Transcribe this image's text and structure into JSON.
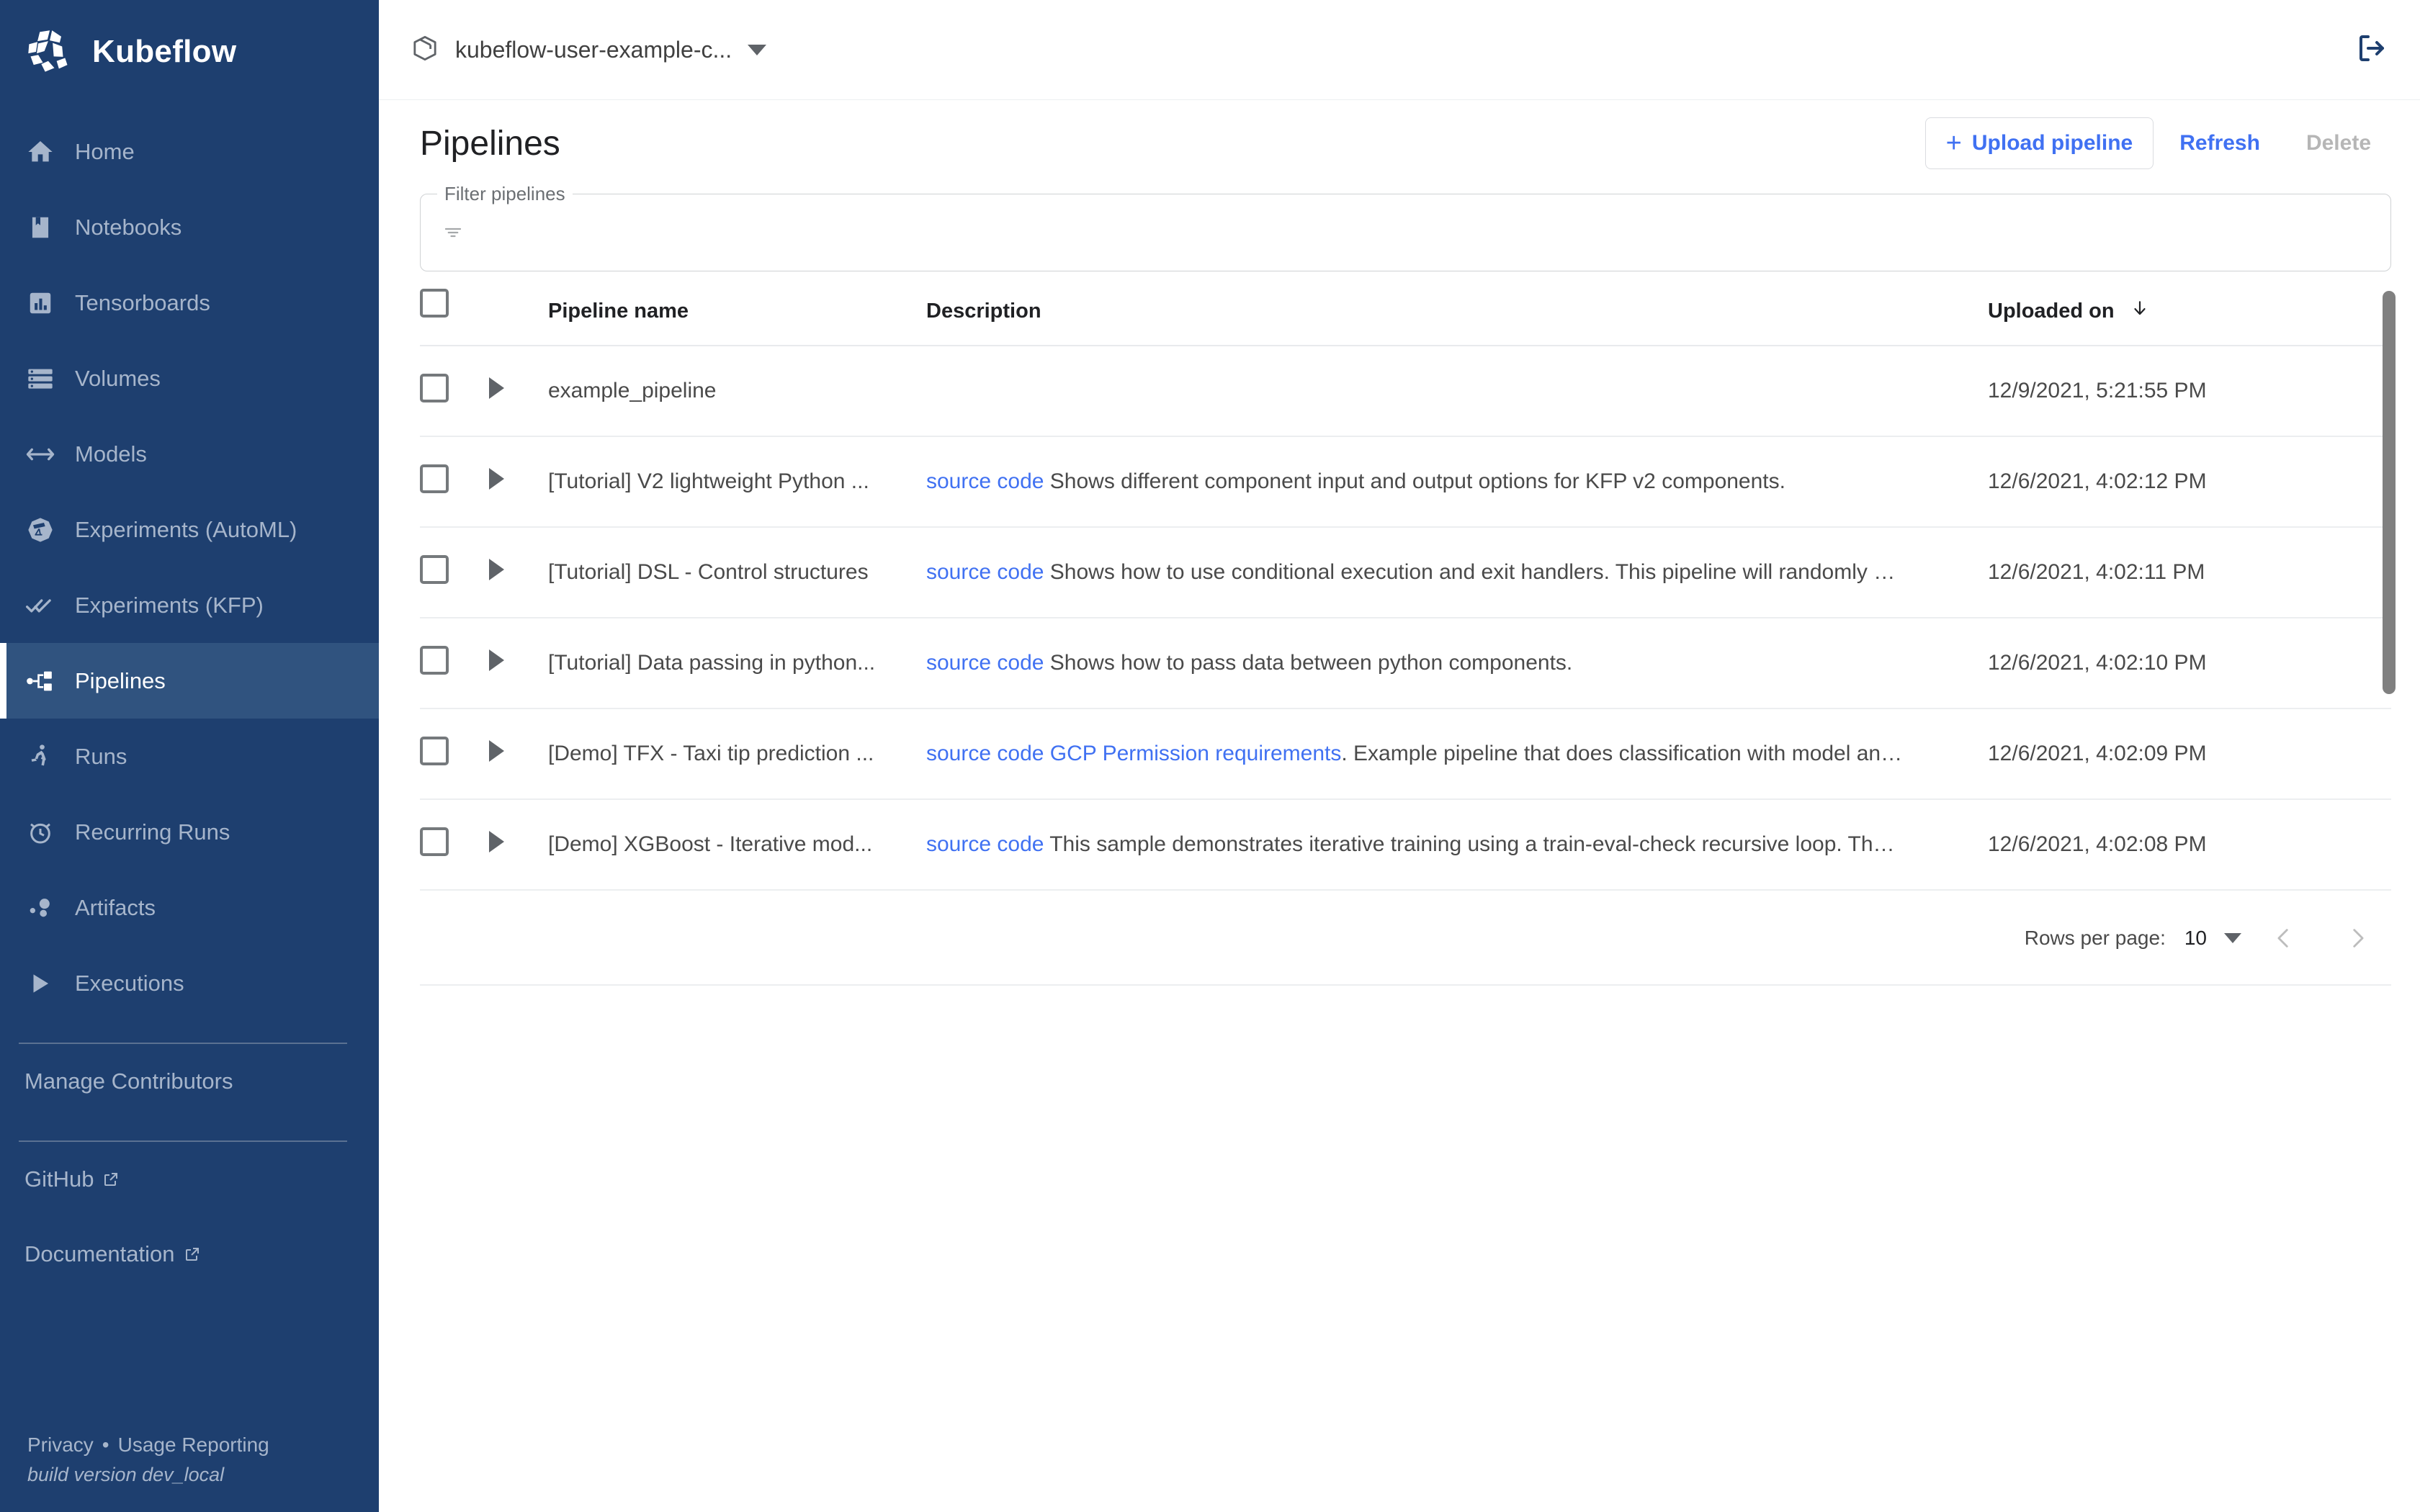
{
  "brand": {
    "name": "Kubeflow",
    "logo_icon": "kubeflow-logo-icon"
  },
  "sidebar": {
    "items": [
      {
        "label": "Home",
        "icon": "home-icon",
        "active": false
      },
      {
        "label": "Notebooks",
        "icon": "notebook-icon",
        "active": false
      },
      {
        "label": "Tensorboards",
        "icon": "bar-chart-icon",
        "active": false
      },
      {
        "label": "Volumes",
        "icon": "storage-icon",
        "active": false
      },
      {
        "label": "Models",
        "icon": "code-arrows-icon",
        "active": false
      },
      {
        "label": "Experiments (AutoML)",
        "icon": "telescope-icon",
        "active": false
      },
      {
        "label": "Experiments (KFP)",
        "icon": "double-check-icon",
        "active": false
      },
      {
        "label": "Pipelines",
        "icon": "pipeline-icon",
        "active": true
      },
      {
        "label": "Runs",
        "icon": "runner-icon",
        "active": false
      },
      {
        "label": "Recurring Runs",
        "icon": "alarm-clock-icon",
        "active": false
      },
      {
        "label": "Artifacts",
        "icon": "artifacts-icon",
        "active": false
      },
      {
        "label": "Executions",
        "icon": "play-triangle-icon",
        "active": false
      }
    ],
    "manage_contributors": "Manage Contributors",
    "github": "GitHub",
    "documentation": "Documentation",
    "privacy": "Privacy",
    "usage_reporting": "Usage Reporting",
    "separator": "•",
    "build_version": "build version dev_local"
  },
  "topbar": {
    "namespace": "kubeflow-user-example-c...",
    "namespace_icon": "package-cube-icon",
    "logout_icon": "logout-icon"
  },
  "page": {
    "title": "Pipelines",
    "upload_label": "Upload pipeline",
    "upload_plus": "+",
    "refresh_label": "Refresh",
    "delete_label": "Delete"
  },
  "filter": {
    "legend": "Filter pipelines",
    "value": "",
    "placeholder": "",
    "icon": "filter-icon"
  },
  "table": {
    "columns": {
      "pipeline_name": "Pipeline name",
      "description": "Description",
      "uploaded_on": "Uploaded on"
    },
    "sort_icon": "arrow-down-icon",
    "rows": [
      {
        "name": "example_pipeline",
        "desc_link": "",
        "desc_link2": "",
        "desc_text": "",
        "uploaded_on": "12/9/2021, 5:21:55 PM"
      },
      {
        "name": "[Tutorial] V2 lightweight Python ...",
        "desc_link": "source code",
        "desc_link2": "",
        "desc_text": " Shows different component input and output options for KFP v2 components.",
        "uploaded_on": "12/6/2021, 4:02:12 PM"
      },
      {
        "name": "[Tutorial] DSL - Control structures",
        "desc_link": "source code",
        "desc_link2": "",
        "desc_text": " Shows how to use conditional execution and exit handlers. This pipeline will randomly …",
        "uploaded_on": "12/6/2021, 4:02:11 PM"
      },
      {
        "name": "[Tutorial] Data passing in python...",
        "desc_link": "source code",
        "desc_link2": "",
        "desc_text": " Shows how to pass data between python components.",
        "uploaded_on": "12/6/2021, 4:02:10 PM"
      },
      {
        "name": "[Demo] TFX - Taxi tip prediction ...",
        "desc_link": "source code",
        "desc_link2": "GCP Permission requirements",
        "desc_text": ". Example pipeline that does classification with model an…",
        "uploaded_on": "12/6/2021, 4:02:09 PM"
      },
      {
        "name": "[Demo] XGBoost - Iterative mod...",
        "desc_link": "source code",
        "desc_link2": "",
        "desc_text": " This sample demonstrates iterative training using a train-eval-check recursive loop. Th…",
        "uploaded_on": "12/6/2021, 4:02:08 PM"
      }
    ]
  },
  "pagination": {
    "rows_per_page_label": "Rows per page:",
    "rows_per_page_value": "10",
    "prev_icon": "chevron-left-icon",
    "next_icon": "chevron-right-icon"
  },
  "colors": {
    "sidebar_bg": "#1e3f6f",
    "sidebar_active_bg": "#30537f",
    "sidebar_text": "#a6b5cb",
    "link_blue": "#4071f2",
    "disabled_gray": "#b6b6b6"
  }
}
